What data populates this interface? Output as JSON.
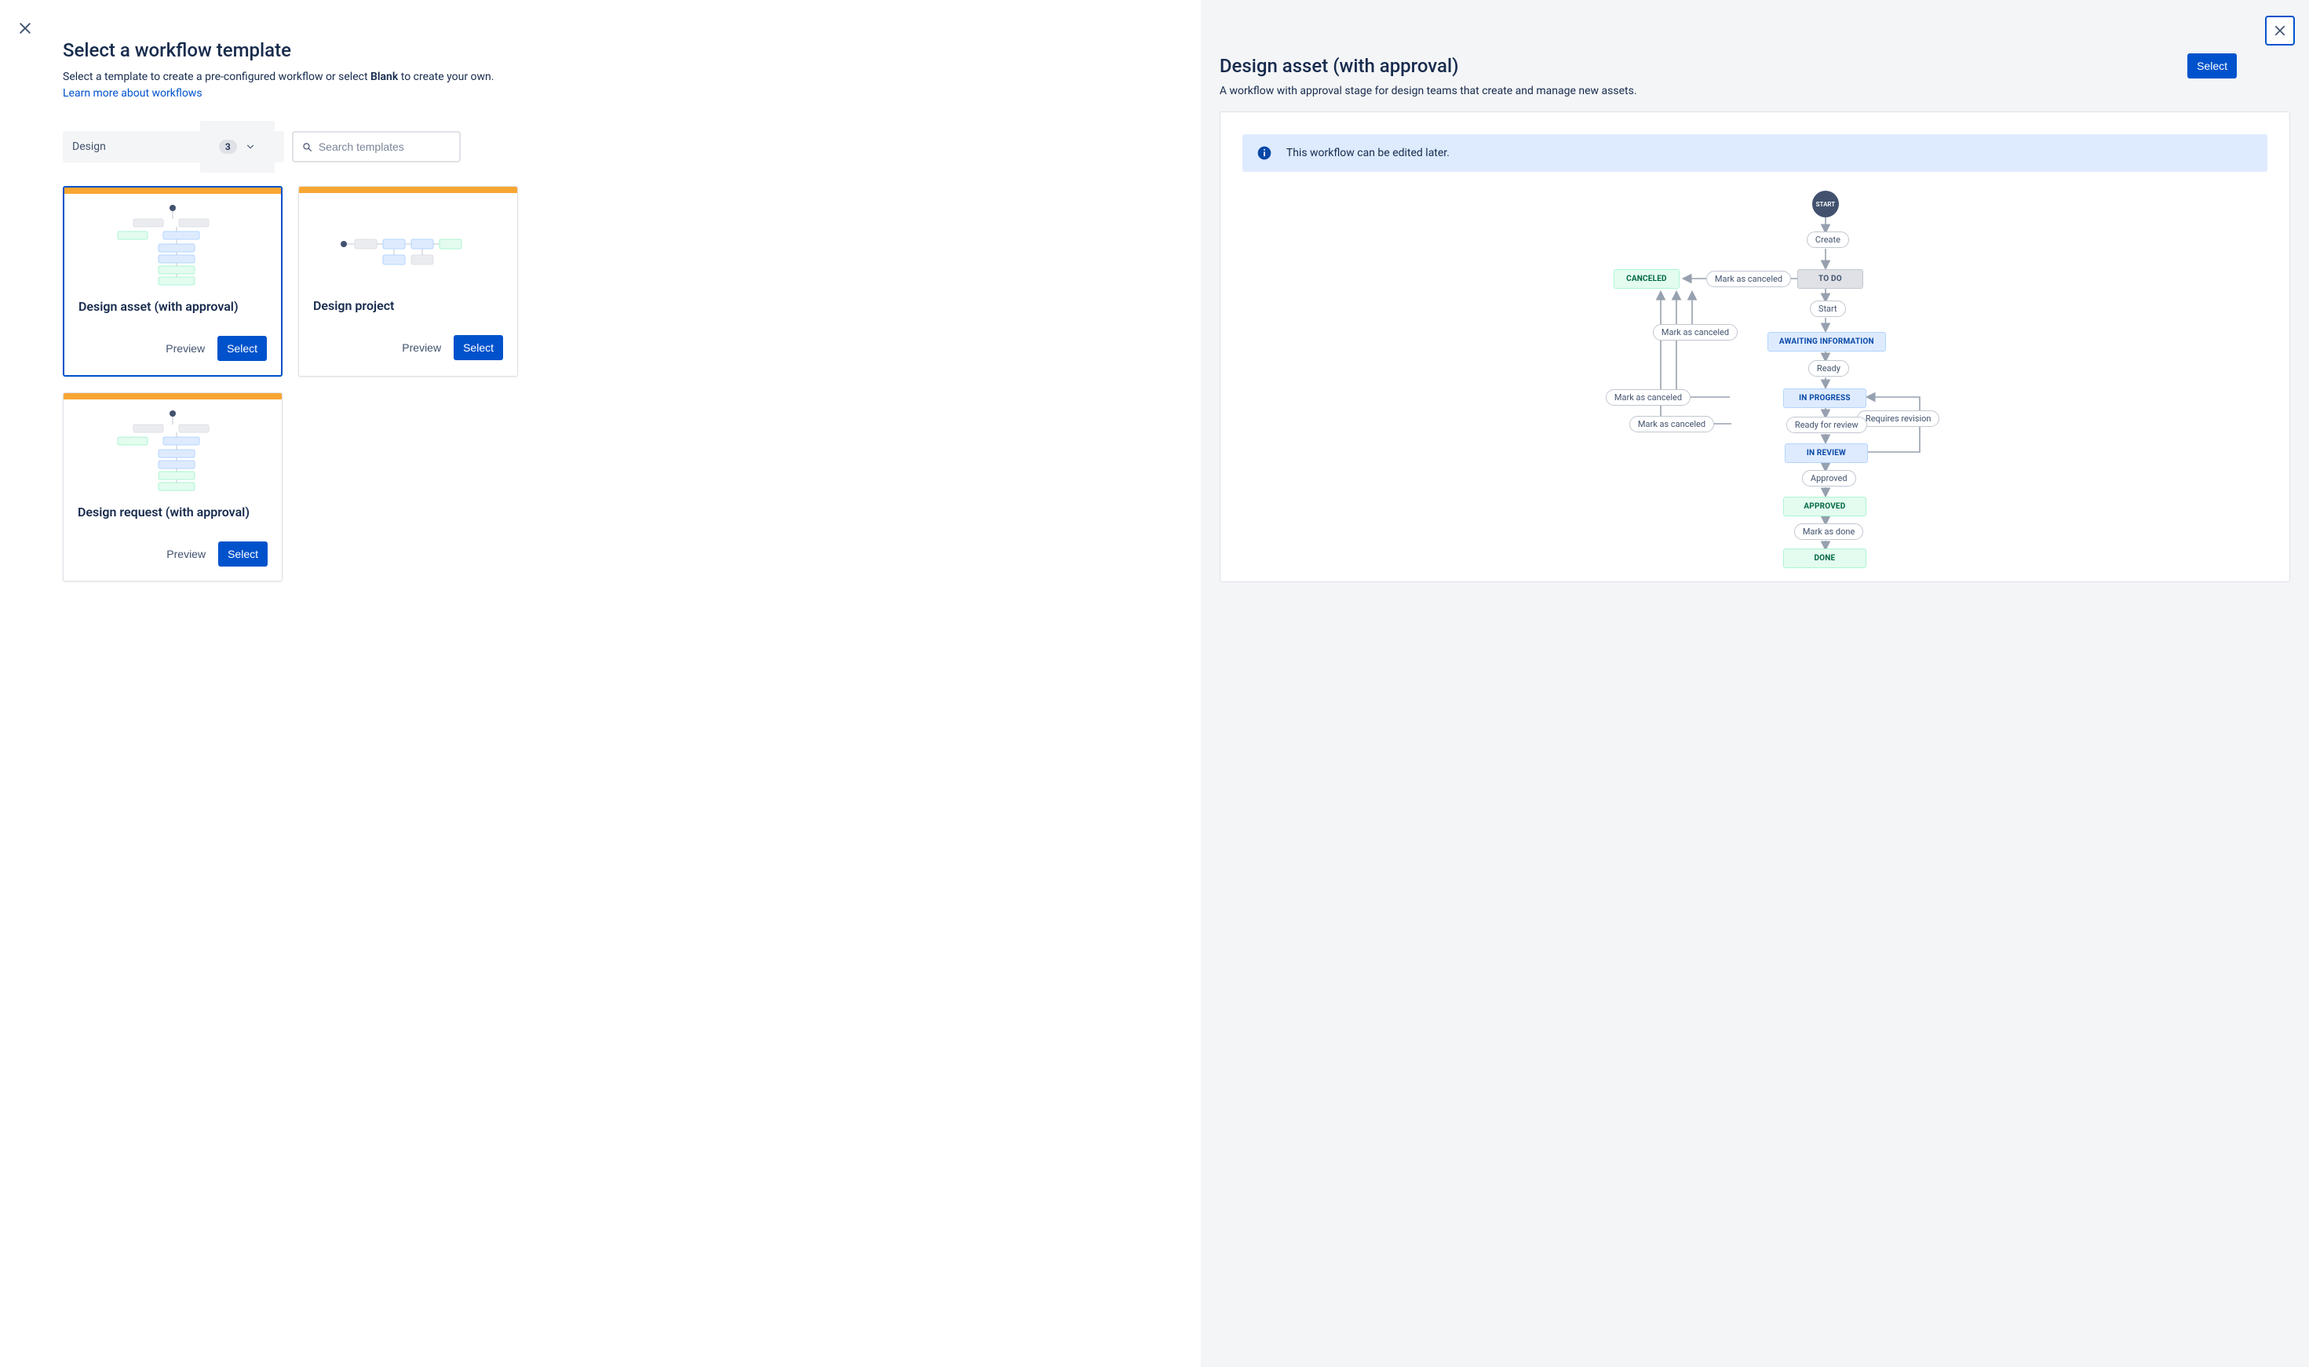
{
  "left": {
    "title": "Select a workflow template",
    "subtitle_pre": "Select a template to create a pre-configured workflow or select ",
    "subtitle_bold": "Blank",
    "subtitle_post": " to create your own.",
    "learn_link": "Learn more about workflows",
    "filter": {
      "category": "Design",
      "count": "3",
      "search_placeholder": "Search templates"
    },
    "cards": [
      {
        "title": "Design asset (with approval)",
        "preview": "Preview",
        "select": "Select",
        "selected": true
      },
      {
        "title": "Design project",
        "preview": "Preview",
        "select": "Select",
        "selected": false
      },
      {
        "title": "Design request (with approval)",
        "preview": "Preview",
        "select": "Select",
        "selected": false
      }
    ]
  },
  "right": {
    "title": "Design asset (with approval)",
    "description": "A workflow with approval stage for design teams that create and manage new assets.",
    "select_label": "Select",
    "info": "This workflow can be edited later.",
    "workflow": {
      "start": "START",
      "statuses": {
        "canceled": "CANCELED",
        "todo": "TO DO",
        "awaiting": "AWAITING INFORMATION",
        "in_progress": "IN PROGRESS",
        "in_review": "IN REVIEW",
        "approved": "APPROVED",
        "done": "DONE"
      },
      "transitions": {
        "create": "Create",
        "mark_cancel_1": "Mark as canceled",
        "start_t": "Start",
        "mark_cancel_2": "Mark as canceled",
        "ready": "Ready",
        "mark_cancel_3": "Mark as canceled",
        "requires_revision": "Requires revision",
        "mark_cancel_4": "Mark as canceled",
        "ready_for_review": "Ready for review",
        "approved_t": "Approved",
        "mark_done": "Mark as done"
      }
    }
  }
}
